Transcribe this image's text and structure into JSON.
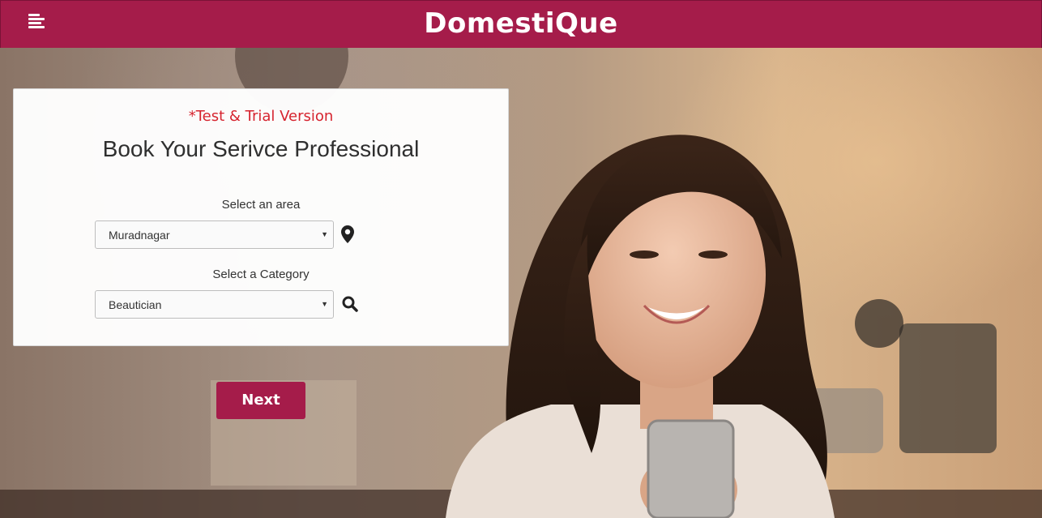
{
  "header": {
    "brand": "DomestiQue",
    "menu_icon": "hamburger-menu-icon",
    "color": "#a51c4a"
  },
  "form": {
    "trial_notice": "*Test & Trial Version",
    "title": "Book Your Serivce Professional",
    "area": {
      "label": "Select an area",
      "selected": "Muradnagar",
      "icon": "map-pin-icon"
    },
    "category": {
      "label": "Select a Category",
      "selected": "Beautician",
      "icon": "search-icon"
    }
  },
  "actions": {
    "next_label": "Next"
  },
  "colors": {
    "accent": "#a51c4a",
    "trial_text": "#d6242f"
  }
}
